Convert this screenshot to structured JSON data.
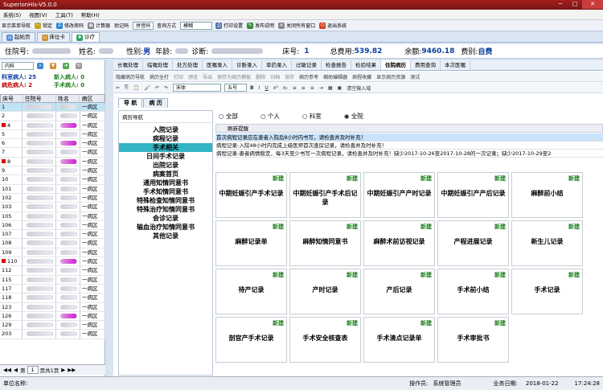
{
  "window": {
    "title": "SuperionHis-V5.0.0",
    "min": "─",
    "max": "□",
    "close": "✕"
  },
  "menu": [
    "系统(S)",
    "视图(V)",
    "工具(T)",
    "帮助(H)"
  ],
  "toolbar": {
    "items": [
      "显示菜单导航",
      "锁定",
      "修改密码",
      "计算器",
      "助记码"
    ],
    "combo1": "拼音码",
    "query_label": "查询方式",
    "combo2": "模糊",
    "print": "打印设置",
    "publish": "发布说明",
    "close_all": "关闭所有窗口",
    "exit": "退出系统"
  },
  "page_tabs": [
    "起始页",
    "床位卡",
    "诊疗"
  ],
  "patient": {
    "id_label": "住院号:",
    "name_label": "姓名:",
    "gender_label": "性别:",
    "gender": "男",
    "age_label": "年龄:",
    "diag_label": "诊断:",
    "bed_label": "床号:",
    "bed": "1",
    "cost_label": "总费用:",
    "cost": "539.82",
    "balance_label": "余额:",
    "balance": "9460.18",
    "feetype_label": "费别:",
    "feetype": "自费"
  },
  "left": {
    "dept": "内科",
    "stats": [
      {
        "label": "科室病人:",
        "value": "25"
      },
      {
        "label": "新入病人:",
        "value": "0"
      },
      {
        "label": "病危病人:",
        "value": "2"
      },
      {
        "label": "手术病人:",
        "value": "0"
      }
    ],
    "headers": [
      "床号",
      "住院号",
      "姓名",
      "病区"
    ],
    "rows": [
      [
        "1",
        "一病区"
      ],
      [
        "2",
        "一病区"
      ],
      [
        "4",
        "一病区"
      ],
      [
        "5",
        "一病区"
      ],
      [
        "6",
        "一病区"
      ],
      [
        "7",
        "一病区"
      ],
      [
        "8",
        "一病区"
      ],
      [
        "9",
        "一病区"
      ],
      [
        "10",
        "一病区"
      ],
      [
        "101",
        "一病区"
      ],
      [
        "102",
        "一病区"
      ],
      [
        "103",
        "一病区"
      ],
      [
        "105",
        "一病区"
      ],
      [
        "106",
        "一病区"
      ],
      [
        "107",
        "一病区"
      ],
      [
        "108",
        "一病区"
      ],
      [
        "109",
        "一病区"
      ],
      [
        "110",
        "一病区"
      ],
      [
        "112",
        "一病区"
      ],
      [
        "115",
        "一病区"
      ],
      [
        "117",
        "一病区"
      ],
      [
        "118",
        "一病区"
      ],
      [
        "123",
        "一病区"
      ],
      [
        "126",
        "一病区"
      ],
      [
        "129",
        "一病区"
      ],
      [
        "203",
        "一病区"
      ]
    ],
    "pager": {
      "page": "1",
      "total": "页共1页"
    }
  },
  "subtabs": [
    "长嘱处理",
    "临嘱处理",
    "处方处理",
    "医嘱录入",
    "诊断录入",
    "草药录入",
    "过敏记录",
    "检查报告",
    "检验结果",
    "住院病历",
    "费用查询",
    "本次医嘱"
  ],
  "edit_toolbar": [
    "隐藏病历导航",
    "病历全打",
    "打印",
    "预览",
    "导出",
    "保存为病历模板",
    "删除",
    "归档",
    "保存",
    "病历参考",
    "缩助编辑器",
    "病程收藏",
    "显示病历资源",
    "测试"
  ],
  "font": {
    "name": "宋体",
    "size": "五号"
  },
  "edit_toolbar2": [
    "清空输入域"
  ],
  "nav_tabs": [
    "导 航",
    "病 历"
  ],
  "nav_header": "病历导航",
  "nav_items": [
    "入院记录",
    "病程记录",
    "手术相关",
    "日间手术记录",
    "出院记录",
    "病案首页",
    "通用知情同意书",
    "手术知情同意书",
    "特殊检查知情同意书",
    "特殊治疗知情同意书",
    "会诊记录",
    "输血治疗知情同意书",
    "其他记录"
  ],
  "radios": [
    "全部",
    "个人",
    "科室",
    "全院"
  ],
  "refresh": "刷新提醒",
  "messages": [
    "首次病程记录应在患者入院后8小时内书写，请检查并及时补充！",
    "病程记录-入院48小时内完成上级医师首次查房记录，请检查并及时补充！",
    "病程记录-患者病情稳定，每3天至少书写一次病程记录，请检查并及时补充！缺少2017-10-26至2017-10-28的一次记录；缺少2017-10-29至2"
  ],
  "new_label": "新建",
  "cards": [
    "中期妊娠引产手术记录",
    "中期妊娠引产手术后记录",
    "中期妊娠引产产时记录",
    "中期妊娠引产产后记录",
    "麻醉前小结",
    "麻醉记录单",
    "麻醉知情同意书",
    "麻醉术前访视记录",
    "产程进展记录",
    "新生儿记录",
    "待产记录",
    "产时记录",
    "产后记录",
    "手术前小结",
    "手术记录",
    "剖宫产手术记录",
    "手术安全核查表",
    "手术清点记录单",
    "手术审批书"
  ],
  "status": {
    "unit_label": "单位名称:",
    "operator_label": "操作员:",
    "operator": "系统管理员",
    "date_label": "业务日期:",
    "date": "2018-01-22",
    "time": "17:24:28"
  }
}
